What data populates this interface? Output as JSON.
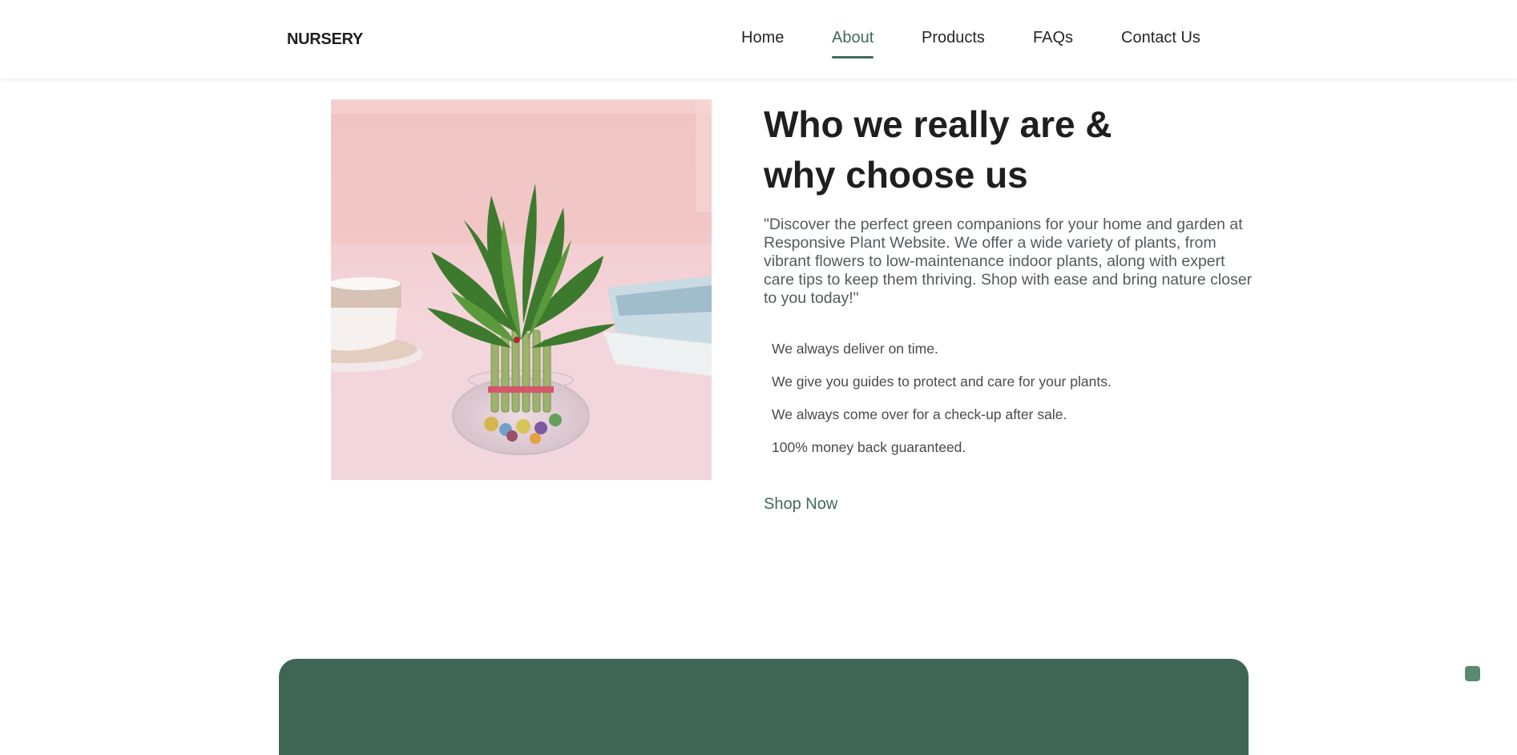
{
  "header": {
    "logo": "NURSERY",
    "nav": [
      {
        "label": "Home",
        "active": false
      },
      {
        "label": "About",
        "active": true
      },
      {
        "label": "Products",
        "active": false
      },
      {
        "label": "FAQs",
        "active": false
      },
      {
        "label": "Contact Us",
        "active": false
      }
    ]
  },
  "about": {
    "image_subject": "lucky-bamboo-plant-in-glass-vase",
    "heading_line1": "Who we really are &",
    "heading_line2": "why choose us",
    "description": "\"Discover the perfect green companions for your home and garden at Responsive Plant Website. We offer a wide variety of plants, from vibrant flowers to low-maintenance indoor plants, along with expert care tips to keep them thriving. Shop with ease and bring nature closer to you today!\"",
    "features": [
      "We always deliver on time.",
      "We give you guides to protect and care for your plants.",
      "We always come over for a check-up after sale.",
      "100% money back guaranteed."
    ],
    "cta": "Shop Now"
  },
  "colors": {
    "accent": "#3f6c56",
    "band": "#3f6654",
    "text": "#262626"
  }
}
